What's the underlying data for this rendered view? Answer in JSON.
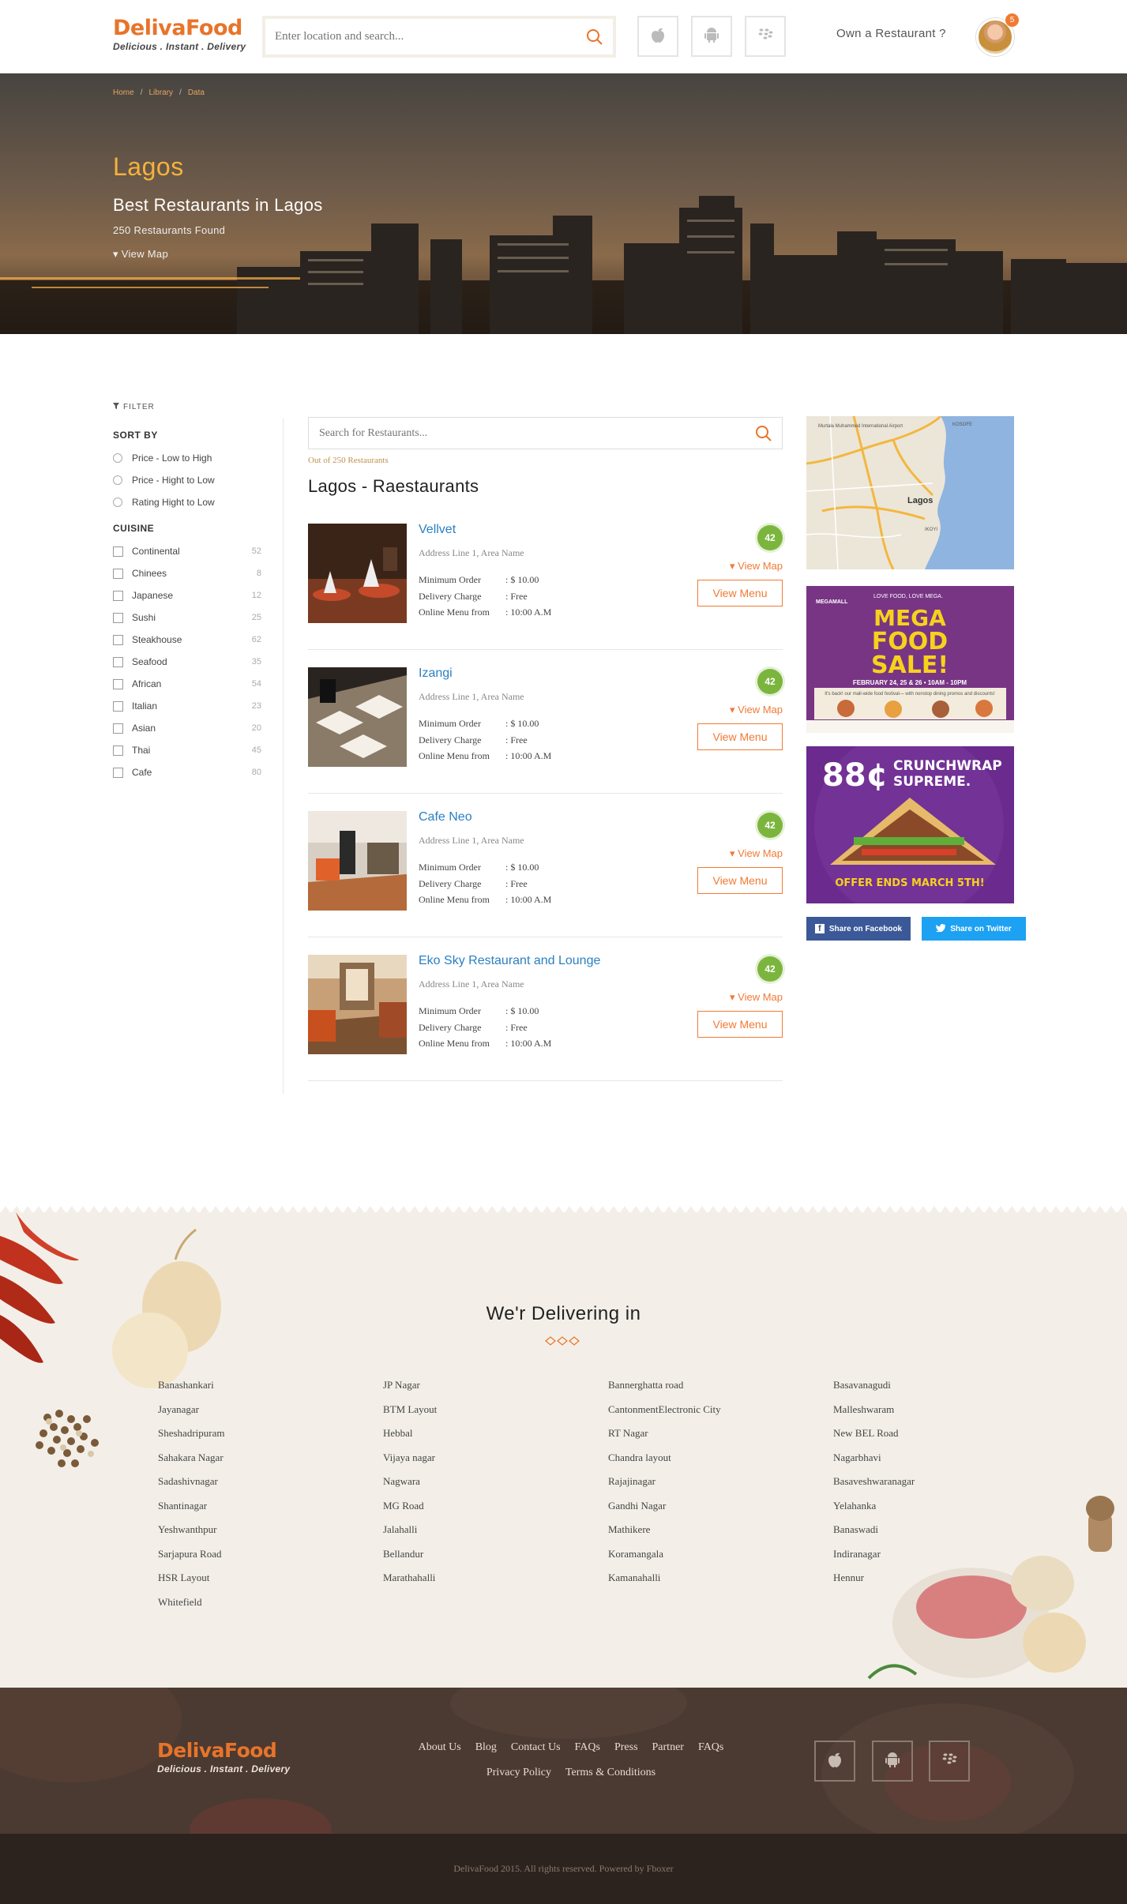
{
  "brand": {
    "name": "DelivaFood",
    "tagline": "Delicious . Instant . Delivery"
  },
  "header": {
    "search_placeholder": "Enter location and search...",
    "own_restaurant": "Own a Restaurant ?",
    "notification_count": "5",
    "app_icons": [
      "apple-icon",
      "android-icon",
      "blackberry-icon"
    ]
  },
  "hero": {
    "breadcrumb": [
      "Home",
      "Library",
      "Data"
    ],
    "city": "Lagos",
    "title": "Best Restaurants in Lagos",
    "found": "250 Restaurants Found",
    "view_map": "View Map"
  },
  "filter": {
    "label": "FILTER",
    "sort_by": "SORT BY",
    "sort_options": [
      "Price - Low to High",
      "Price - Hight to Low",
      "Rating Hight to Low"
    ],
    "cuisine": "CUISINE",
    "cuisines": [
      {
        "name": "Continental",
        "count": "52"
      },
      {
        "name": "Chinees",
        "count": "8"
      },
      {
        "name": "Japanese",
        "count": "12"
      },
      {
        "name": "Sushi",
        "count": "25"
      },
      {
        "name": "Steakhouse",
        "count": "62"
      },
      {
        "name": "Seafood",
        "count": "35"
      },
      {
        "name": "African",
        "count": "54"
      },
      {
        "name": "Italian",
        "count": "23"
      },
      {
        "name": "Asian",
        "count": "20"
      },
      {
        "name": "Thai",
        "count": "45"
      },
      {
        "name": "Cafe",
        "count": "80"
      }
    ]
  },
  "list": {
    "search_placeholder": "Search for Restaurants...",
    "out_of": "Out of 250 Restaurants",
    "title": "Lagos - Raestaurants",
    "labels": {
      "min_order": "Minimum Order",
      "delivery": "Delivery Charge",
      "menu_from": "Online Menu from",
      "view_map": "View Map",
      "view_menu": "View Menu"
    },
    "restaurants": [
      {
        "name": "Vellvet",
        "address": "Address Line 1, Area Name",
        "min_order": ": $ 10.00",
        "delivery": ": Free",
        "menu_from": ": 10:00 A.M",
        "rating": "42"
      },
      {
        "name": "Izangi",
        "address": "Address Line 1, Area Name",
        "min_order": ": $ 10.00",
        "delivery": ": Free",
        "menu_from": ": 10:00 A.M",
        "rating": "42"
      },
      {
        "name": "Cafe Neo",
        "address": "Address Line 1, Area Name",
        "min_order": ": $ 10.00",
        "delivery": ": Free",
        "menu_from": ": 10:00 A.M",
        "rating": "42"
      },
      {
        "name": "Eko Sky Restaurant and Lounge",
        "address": "Address Line 1, Area Name",
        "min_order": ": $ 10.00",
        "delivery": ": Free",
        "menu_from": ": 10:00 A.M",
        "rating": "42"
      }
    ]
  },
  "sidebar": {
    "map_label": "Lagos",
    "map_label_2": "Murtala Muhammed International Airport",
    "map_label_3": "IKOYI",
    "map_label_4": "KOSOFE",
    "ad1": {
      "top": "MEGAMALL",
      "tag": "LOVE FOOD, LOVE MEGA.",
      "line1": "MEGA",
      "line2": "FOOD",
      "line3": "SALE!",
      "dates": "FEBRUARY 24, 25 & 26 • 10AM - 10PM",
      "sub": "It's back! our mall-wide food festival— with nonstop dining promos and discounts!"
    },
    "ad2": {
      "price": "88¢",
      "name1": "CRUNCHWRAP",
      "name2": "SUPREME.",
      "offer": "OFFER ENDS MARCH 5TH!"
    },
    "share_facebook": "Share on Facebook",
    "share_twitter": "Share on Twitter"
  },
  "delivering": {
    "title": "We'r Delivering in",
    "columns": [
      [
        "Banashankari",
        "Jayanagar",
        "Sheshadripuram",
        "Sahakara Nagar",
        "Sadashivnagar",
        "Shantinagar",
        "Yeshwanthpur",
        "Sarjapura Road",
        "HSR Layout",
        "Whitefield"
      ],
      [
        "JP Nagar",
        "BTM Layout",
        "Hebbal",
        "Vijaya nagar",
        "Nagwara",
        "MG Road",
        "Jalahalli",
        "Bellandur",
        "Marathahalli"
      ],
      [
        "Bannerghatta road",
        "CantonmentElectronic City",
        "RT Nagar",
        "Chandra layout",
        "Rajajinagar",
        "Gandhi Nagar",
        "Mathikere",
        "Koramangala",
        "Kamanahalli"
      ],
      [
        "Basavanagudi",
        "Malleshwaram",
        "New BEL Road",
        "Nagarbhavi",
        "Basaveshwaranagar",
        "Yelahanka",
        "Banaswadi",
        "Indiranagar",
        "Hennur"
      ]
    ]
  },
  "footer": {
    "links_row1": [
      "About Us",
      "Blog",
      "Contact Us",
      "FAQs",
      "Press",
      "Partner",
      "FAQs"
    ],
    "links_row2": [
      "Privacy Policy",
      "Terms & Conditions"
    ],
    "copyright": "DelivaFood 2015. All rights reserved. Powered by Fboxer"
  },
  "colors": {
    "brand": "#e8742a",
    "link": "#2a7fc1",
    "rating": "#7bb53e",
    "hero_city": "#f4b23c"
  }
}
